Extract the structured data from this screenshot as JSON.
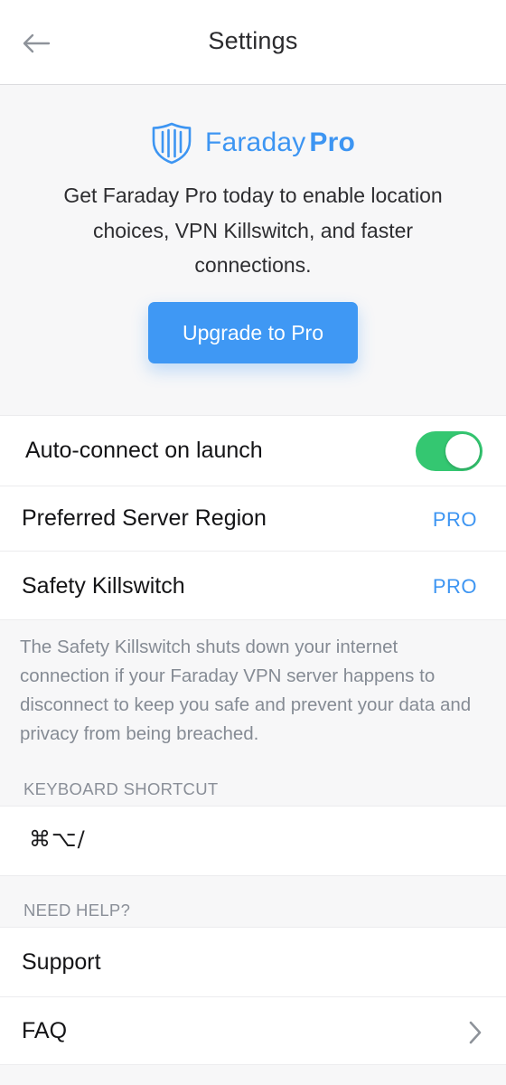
{
  "header": {
    "title": "Settings",
    "back_icon": "arrow-left-icon"
  },
  "promo": {
    "brand_icon": "shield-icon",
    "brand_name": "Faraday",
    "brand_pro": "Pro",
    "description": "Get Faraday Pro today to enable location choices, VPN Killswitch, and faster connections.",
    "upgrade_label": "Upgrade to Pro",
    "accent_color": "#3f98f4"
  },
  "settings": {
    "auto_connect": {
      "label": "Auto-connect on launch",
      "enabled": true,
      "toggle_color": "#34c771"
    },
    "server_region": {
      "label": "Preferred Server Region",
      "badge": "PRO"
    },
    "killswitch": {
      "label": "Safety Killswitch",
      "badge": "PRO",
      "description": "The Safety Killswitch shuts down your internet connection if your Faraday VPN server happens to disconnect to keep you safe and prevent your data and privacy from being breached."
    }
  },
  "keyboard": {
    "section_title": "KEYBOARD SHORTCUT",
    "shortcut": "⌘⌥/"
  },
  "help": {
    "section_title": "NEED HELP?",
    "items": [
      {
        "label": "Support"
      },
      {
        "label": "FAQ",
        "icon": "chevron-right-icon"
      }
    ]
  }
}
